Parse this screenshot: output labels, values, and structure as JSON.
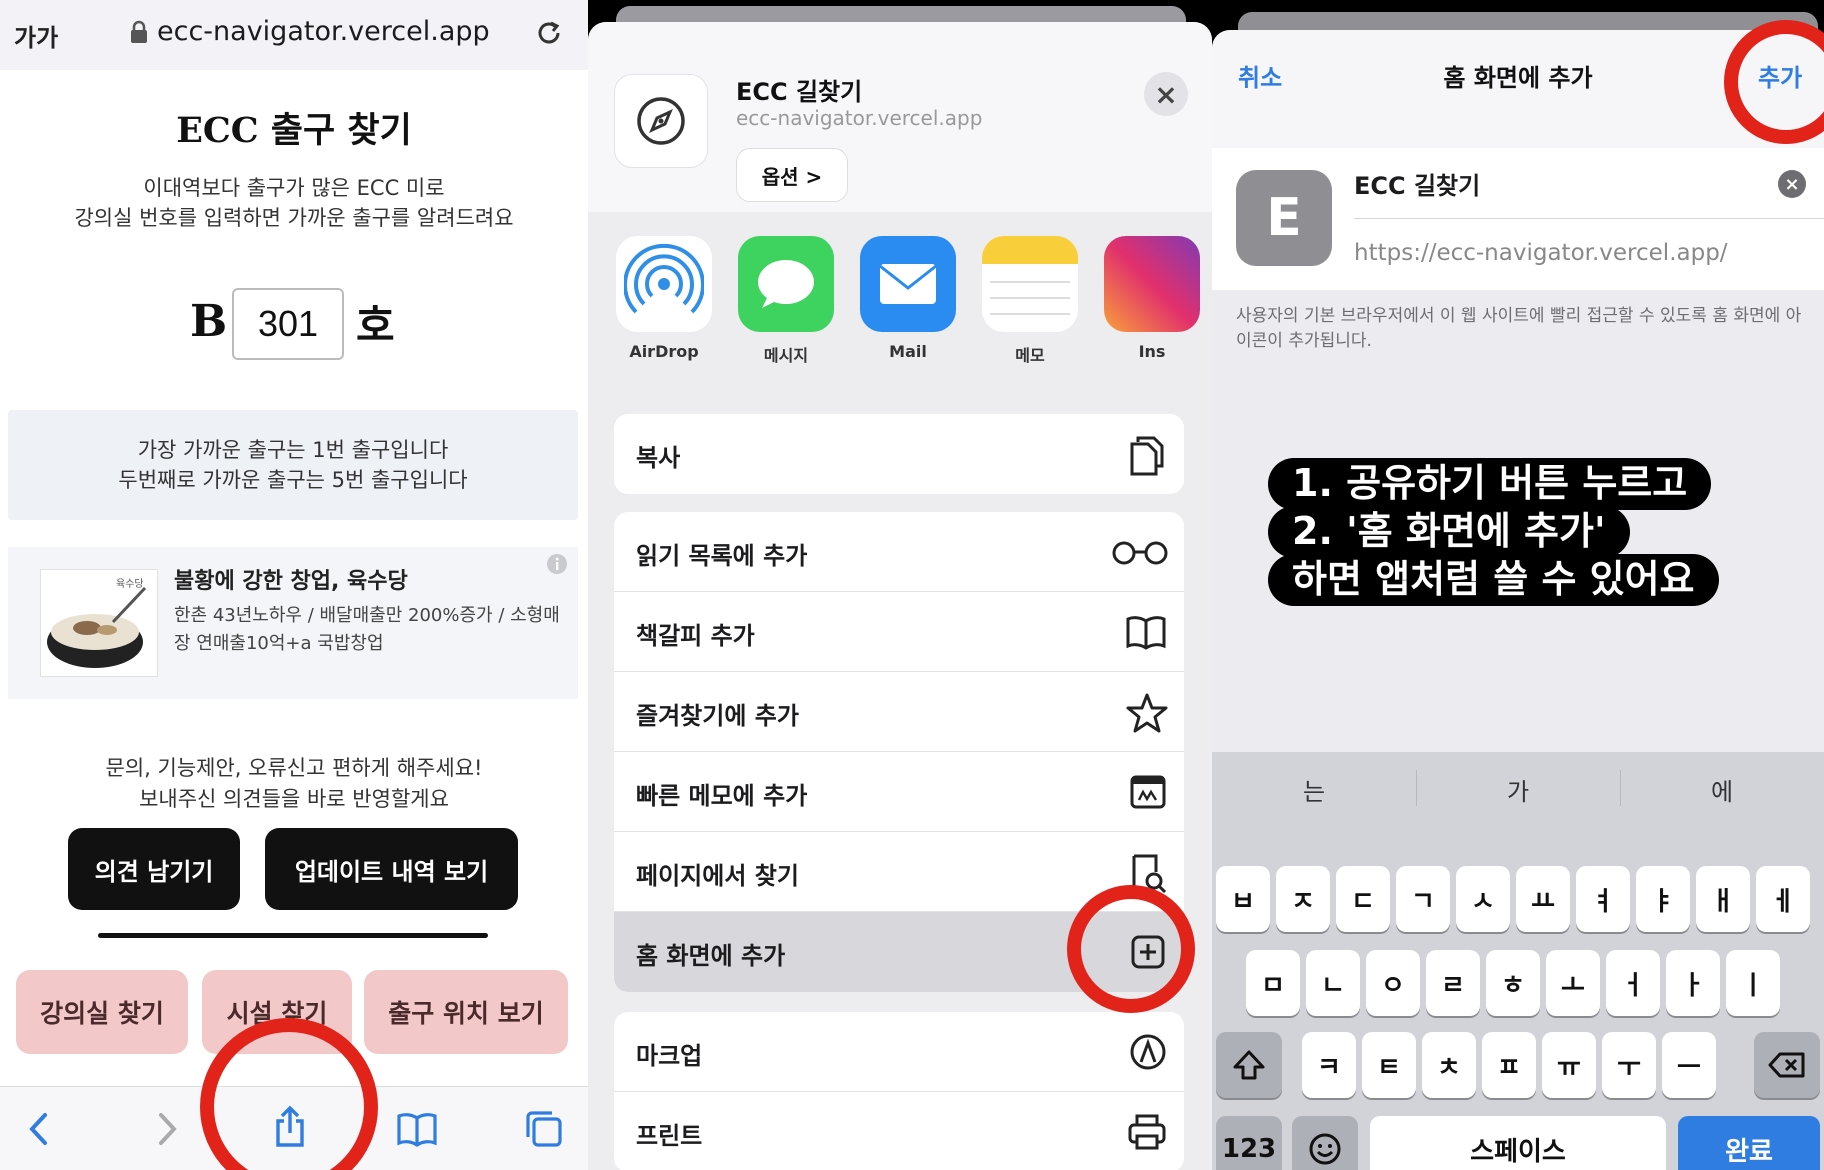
{
  "panel1": {
    "browser": {
      "aa": "가가",
      "url": "ecc-navigator.vercel.app"
    },
    "title": "ECC 출구 찾기",
    "subtitle_lines": [
      "이대역보다 출구가 많은 ECC 미로",
      "강의실 번호를 입력하면 가까운 출구를 알려드려요"
    ],
    "room_prefix": "B",
    "room_value": "301",
    "room_suffix": "호",
    "result_lines": [
      "가장 가까운 출구는 1번 출구입니다",
      "두번째로 가까운 출구는 5번 출구입니다"
    ],
    "ad": {
      "brand": "육수당",
      "title": "불황에 강한 창업, 육수당",
      "desc": "한촌 43년노하우 / 배달매출만 200%증가 / 소형매장 연매출10억+a 국밥창업"
    },
    "feedback_lines": [
      "문의, 기능제안, 오류신고 편하게 해주세요!",
      "보내주신 의견들을 바로 반영할게요"
    ],
    "buttons": {
      "feedback": "의견 남기기",
      "updates": "업데이트 내역 보기"
    },
    "tabs": [
      "강의실 찾기",
      "시설 찾기",
      "출구 위치 보기"
    ]
  },
  "panel2": {
    "header": {
      "title": "ECC 길찾기",
      "url": "ecc-navigator.vercel.app",
      "options": "옵션 >"
    },
    "apps": [
      {
        "label": "AirDrop",
        "icon": "airdrop-icon"
      },
      {
        "label": "메시지",
        "icon": "messages-icon"
      },
      {
        "label": "Mail",
        "icon": "mail-icon"
      },
      {
        "label": "메모",
        "icon": "notes-icon"
      },
      {
        "label": "Ins",
        "icon": "instagram-icon"
      }
    ],
    "copy": "복사",
    "actions": [
      "읽기 목록에 추가",
      "책갈피 추가",
      "즐겨찾기에 추가",
      "빠른 메모에 추가",
      "페이지에서 찾기",
      "홈 화면에 추가"
    ],
    "actions2": [
      "마크업",
      "프린트"
    ]
  },
  "panel3": {
    "nav": {
      "cancel": "취소",
      "title": "홈 화면에 추가",
      "add": "추가"
    },
    "icon_letter": "E",
    "name": "ECC 길찾기",
    "url": "https://ecc-navigator.vercel.app/",
    "description": "사용자의 기본 브라우저에서 이 웹 사이트에 빨리 접근할 수 있도록 홈 화면에 아이콘이 추가됩니다.",
    "caption": [
      "1. 공유하기 버튼 누르고",
      "2. '홈 화면에 추가'",
      "하면 앱처럼 쓸 수 있어요"
    ],
    "suggestions": [
      "는",
      "가",
      "에"
    ],
    "row1": [
      "ㅂ",
      "ㅈ",
      "ㄷ",
      "ㄱ",
      "ㅅ",
      "ㅛ",
      "ㅕ",
      "ㅑ",
      "ㅐ",
      "ㅔ"
    ],
    "row2": [
      "ㅁ",
      "ㄴ",
      "ㅇ",
      "ㄹ",
      "ㅎ",
      "ㅗ",
      "ㅓ",
      "ㅏ",
      "ㅣ"
    ],
    "row3": [
      "ㅋ",
      "ㅌ",
      "ㅊ",
      "ㅍ",
      "ㅠ",
      "ㅜ",
      "ㅡ"
    ],
    "key_123": "123",
    "key_space": "스페이스",
    "key_done": "완료"
  },
  "colors": {
    "accent_blue": "#2f7de0",
    "highlight_red": "#e2231a",
    "pink_button": "#f3c8c8"
  }
}
